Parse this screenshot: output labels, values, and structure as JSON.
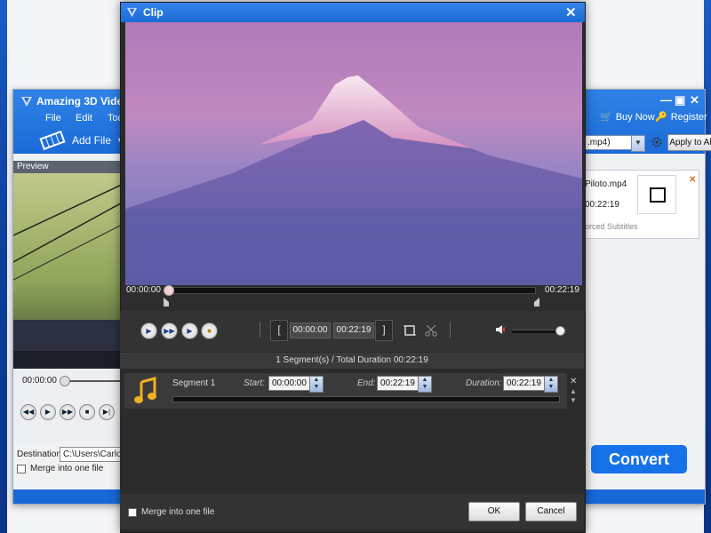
{
  "background_app": {
    "title": "Amazing 3D Video",
    "menu": [
      "File",
      "Edit",
      "Toc"
    ],
    "add_file_label": "Add File",
    "buy_now_label": "Buy Now",
    "register_label": "Register",
    "profile_value": ".mp4)",
    "apply_to_all_label": "Apply to All",
    "preview_label": "Preview",
    "player_time": "00:00:00",
    "destination_label": "Destination:",
    "destination_value": "C:\\Users\\Carlos\\",
    "merge_label": "Merge into one file",
    "file_item": {
      "name": "Piloto.mp4",
      "duration": "00:22:19",
      "subtitle_text": "orced Subtitles"
    },
    "convert_label": "Convert"
  },
  "clip_dialog": {
    "title": "Clip",
    "time_start": "00:00:00",
    "time_end": "00:22:19",
    "bracket_start_time": "00:00:00",
    "bracket_end_time": "00:22:19",
    "segment_summary": "1 Segment(s) / Total Duration 00:22:19",
    "segment": {
      "name": "Segment 1",
      "start_label": "Start:",
      "start_value": "00:00:00",
      "end_label": "End:",
      "end_value": "00:22:19",
      "duration_label": "Duration:",
      "duration_value": "00:22:19"
    },
    "merge_label": "Merge into one file",
    "ok_label": "OK",
    "cancel_label": "Cancel",
    "volume_level": 0.95
  },
  "icons": [
    "app-logo-icon",
    "play-icon",
    "fast-forward-icon",
    "step-icon",
    "stop-icon",
    "crop-icon",
    "scissors-icon",
    "volume-icon",
    "music-note-icon",
    "close-icon",
    "cart-icon",
    "key-icon",
    "settings-icon"
  ]
}
